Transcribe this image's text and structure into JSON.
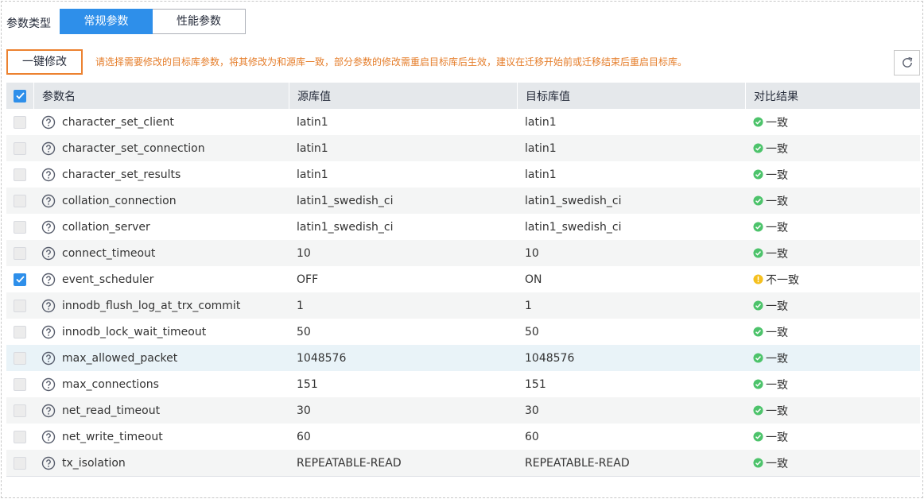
{
  "param_type_label": "参数类型",
  "tabs": [
    {
      "label": "常规参数",
      "active": true
    },
    {
      "label": "性能参数",
      "active": false
    }
  ],
  "toolbar": {
    "onekey_label": "一键修改",
    "tip": "请选择需要修改的目标库参数，将其修改为和源库一致，部分参数的修改需重启目标库后生效，建议在迁移开始前或迁移结束后重启目标库。",
    "refresh_icon": "refresh-icon"
  },
  "table": {
    "headers": {
      "name": "参数名",
      "source": "源库值",
      "target": "目标库值",
      "result": "对比结果"
    },
    "rows": [
      {
        "name": "character_set_client",
        "source": "latin1",
        "target": "latin1",
        "result": "一致",
        "status": "ok",
        "checked": false
      },
      {
        "name": "character_set_connection",
        "source": "latin1",
        "target": "latin1",
        "result": "一致",
        "status": "ok",
        "checked": false
      },
      {
        "name": "character_set_results",
        "source": "latin1",
        "target": "latin1",
        "result": "一致",
        "status": "ok",
        "checked": false
      },
      {
        "name": "collation_connection",
        "source": "latin1_swedish_ci",
        "target": "latin1_swedish_ci",
        "result": "一致",
        "status": "ok",
        "checked": false
      },
      {
        "name": "collation_server",
        "source": "latin1_swedish_ci",
        "target": "latin1_swedish_ci",
        "result": "一致",
        "status": "ok",
        "checked": false
      },
      {
        "name": "connect_timeout",
        "source": "10",
        "target": "10",
        "result": "一致",
        "status": "ok",
        "checked": false
      },
      {
        "name": "event_scheduler",
        "source": "OFF",
        "target": "ON",
        "result": "不一致",
        "status": "warn",
        "checked": true
      },
      {
        "name": "innodb_flush_log_at_trx_commit",
        "source": "1",
        "target": "1",
        "result": "一致",
        "status": "ok",
        "checked": false
      },
      {
        "name": "innodb_lock_wait_timeout",
        "source": "50",
        "target": "50",
        "result": "一致",
        "status": "ok",
        "checked": false
      },
      {
        "name": "max_allowed_packet",
        "source": "1048576",
        "target": "1048576",
        "result": "一致",
        "status": "ok",
        "checked": false
      },
      {
        "name": "max_connections",
        "source": "151",
        "target": "151",
        "result": "一致",
        "status": "ok",
        "checked": false
      },
      {
        "name": "net_read_timeout",
        "source": "30",
        "target": "30",
        "result": "一致",
        "status": "ok",
        "checked": false
      },
      {
        "name": "net_write_timeout",
        "source": "60",
        "target": "60",
        "result": "一致",
        "status": "ok",
        "checked": false
      },
      {
        "name": "tx_isolation",
        "source": "REPEATABLE-READ",
        "target": "REPEATABLE-READ",
        "result": "一致",
        "status": "ok",
        "checked": false
      }
    ]
  },
  "colors": {
    "primary": "#2e8fea",
    "ok": "#4dc36b",
    "warn": "#f5c01f",
    "tip": "#e57d2a",
    "highlight_border": "#ec8230"
  }
}
